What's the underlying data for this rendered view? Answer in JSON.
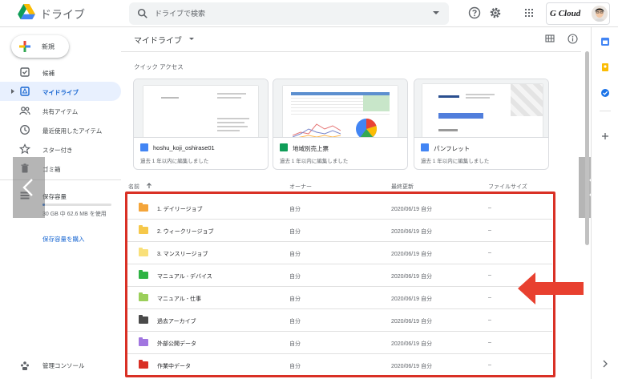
{
  "header": {
    "app_name": "ドライブ",
    "search_placeholder": "ドライブで検索",
    "brand_badge": "G Cloud"
  },
  "sidebar": {
    "new_label": "新規",
    "items": [
      {
        "label": "候補",
        "icon": "check-box-icon"
      },
      {
        "label": "マイドライブ",
        "icon": "my-drive-icon",
        "active": true
      },
      {
        "label": "共有アイテム",
        "icon": "people-icon"
      },
      {
        "label": "最近使用したアイテム",
        "icon": "clock-icon"
      },
      {
        "label": "スター付き",
        "icon": "star-icon"
      },
      {
        "label": "ゴミ箱",
        "icon": "trash-icon"
      },
      {
        "label": "保存容量",
        "icon": "storage-icon"
      }
    ],
    "storage_usage": "30 GB 中 62.6 MB を使用",
    "buy_storage": "保存容量を購入",
    "admin_console": "管理コンソール"
  },
  "main": {
    "title": "マイドライブ",
    "quick_access_label": "クイック アクセス",
    "quick_access": [
      {
        "name": "hoshu_koji_oshirase01",
        "sub": "過去 1 年以内に編集しました",
        "type": "doc",
        "color": "#4285f4"
      },
      {
        "name": "地域別売上票",
        "sub": "過去 1 年以内に編集しました",
        "type": "sheet",
        "color": "#0f9d58"
      },
      {
        "name": "パンフレット",
        "sub": "過去 1 年以内に編集しました",
        "type": "doc",
        "color": "#4285f4"
      }
    ],
    "columns": {
      "name": "名前",
      "owner": "オーナー",
      "modified": "最終更新",
      "size": "ファイルサイズ"
    },
    "files": [
      {
        "name": "1. デイリージョブ",
        "owner": "自分",
        "modified": "2020/06/19 自分",
        "size": "–",
        "color": "#f4a53a"
      },
      {
        "name": "2. ウィークリージョブ",
        "owner": "自分",
        "modified": "2020/06/19 自分",
        "size": "–",
        "color": "#f6c84a"
      },
      {
        "name": "3. マンスリージョブ",
        "owner": "自分",
        "modified": "2020/06/19 自分",
        "size": "–",
        "color": "#f9e07a"
      },
      {
        "name": "マニュアル - デバイス",
        "owner": "自分",
        "modified": "2020/06/19 自分",
        "size": "–",
        "color": "#2fb344"
      },
      {
        "name": "マニュアル - 仕事",
        "owner": "自分",
        "modified": "2020/06/19 自分",
        "size": "–",
        "color": "#9bcf5a"
      },
      {
        "name": "過去アーカイブ",
        "owner": "自分",
        "modified": "2020/06/19 自分",
        "size": "–",
        "color": "#4a4a4a"
      },
      {
        "name": "外部公開データ",
        "owner": "自分",
        "modified": "2020/06/19 自分",
        "size": "–",
        "color": "#a176e0"
      },
      {
        "name": "作業中データ",
        "owner": "自分",
        "modified": "2020/06/19 自分",
        "size": "–",
        "color": "#d93025"
      }
    ]
  }
}
